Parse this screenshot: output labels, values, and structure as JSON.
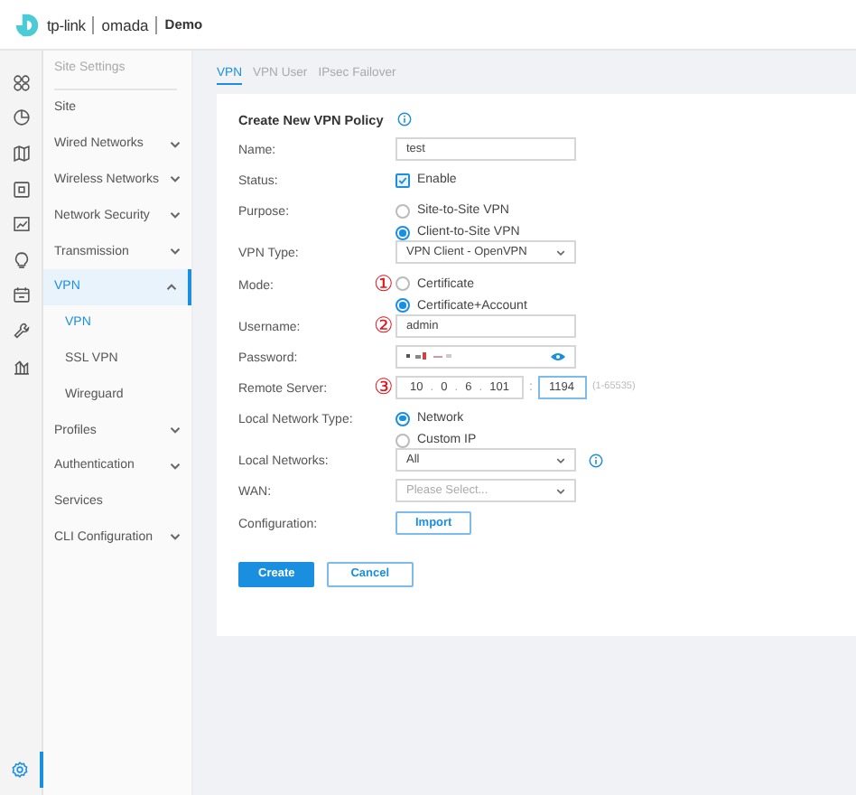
{
  "header": {
    "brand": "tp-link",
    "product": "omada",
    "site": "Demo"
  },
  "rail": {
    "icons": [
      {
        "kind": "grid"
      },
      {
        "kind": "pie"
      },
      {
        "kind": "map"
      },
      {
        "kind": "device"
      },
      {
        "kind": "chart"
      },
      {
        "kind": "bulb"
      },
      {
        "kind": "calendar"
      },
      {
        "kind": "wrench"
      },
      {
        "kind": "bars"
      }
    ],
    "settings": {
      "selected": true
    }
  },
  "sidebar": {
    "heading": "Site Settings",
    "items": [
      {
        "label": "Site",
        "selected": false
      },
      {
        "label": "Wired Networks",
        "expanded": false,
        "selected": false
      },
      {
        "label": "Wireless Networks",
        "expanded": false,
        "selected": false
      },
      {
        "label": "Network Security",
        "expanded": false,
        "selected": false
      },
      {
        "label": "Transmission",
        "expanded": false,
        "selected": false
      },
      {
        "label": "VPN",
        "expanded": true,
        "selected": true,
        "children": [
          {
            "label": "VPN",
            "selected": true
          },
          {
            "label": "SSL VPN",
            "selected": false
          },
          {
            "label": "Wireguard",
            "selected": false
          }
        ]
      },
      {
        "label": "Profiles",
        "expanded": false,
        "selected": false
      },
      {
        "label": "Authentication",
        "expanded": false,
        "selected": false
      },
      {
        "label": "Services",
        "selected": false
      },
      {
        "label": "CLI Configuration",
        "expanded": false,
        "selected": false
      }
    ]
  },
  "tabs": [
    {
      "label": "VPN",
      "selected": true
    },
    {
      "label": "VPN User",
      "selected": false
    },
    {
      "label": "IPsec Failover",
      "selected": false
    }
  ],
  "form": {
    "title": "Create New VPN Policy",
    "rows": [
      {
        "kind": "text",
        "label": "Name:",
        "value": "test"
      },
      {
        "kind": "checkbox",
        "label": "Status:",
        "options": [
          {
            "label": "Enable",
            "checked": true
          }
        ]
      },
      {
        "kind": "radio",
        "label": "Purpose:",
        "options": [
          {
            "label": "Site-to-Site VPN",
            "selected": false
          },
          {
            "label": "Client-to-Site VPN",
            "selected": true
          }
        ]
      },
      {
        "kind": "select",
        "label": "VPN Type:",
        "value": "VPN Client - OpenVPN"
      },
      {
        "kind": "radio",
        "label": "Mode:",
        "marker": "①",
        "options": [
          {
            "label": "Certificate",
            "selected": false
          },
          {
            "label": "Certificate+Account",
            "selected": true
          }
        ]
      },
      {
        "kind": "text",
        "label": "Username:",
        "marker": "②",
        "value": "admin"
      },
      {
        "kind": "password",
        "label": "Password:"
      },
      {
        "kind": "server",
        "label": "Remote Server:",
        "marker": "③",
        "octets": [
          "10",
          "0",
          "6",
          "101"
        ],
        "separator": ".",
        "port_separator": ":",
        "port": "1194",
        "hint": "(1-65535)"
      },
      {
        "kind": "radio",
        "label": "Local Network Type:",
        "options": [
          {
            "label": "Network",
            "selected": true
          },
          {
            "label": "Custom IP",
            "selected": false
          }
        ]
      },
      {
        "kind": "select",
        "label": "Local Networks:",
        "value": "All",
        "info": true
      },
      {
        "kind": "select",
        "label": "WAN:",
        "placeholder": "Please Select..."
      },
      {
        "kind": "button",
        "label": "Configuration:",
        "button": "Import"
      }
    ]
  },
  "buttons": [
    {
      "label": "Create",
      "primary": true
    },
    {
      "label": "Cancel",
      "primary": false
    }
  ]
}
